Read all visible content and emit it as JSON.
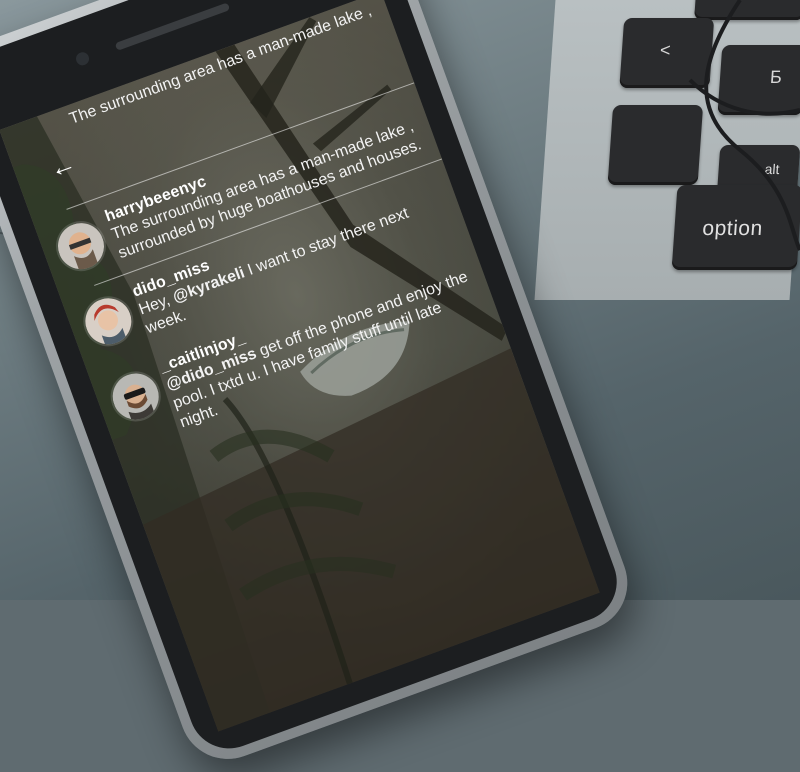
{
  "keyboard": {
    "keys": {
      "lt": "<",
      "cyr": "Б",
      "alt": "alt",
      "option": "option"
    }
  },
  "screen": {
    "back_icon": "arrow-left-icon",
    "comments": [
      {
        "username": "",
        "text": "The surrounding area has a man-made lake ,"
      },
      {
        "username": "harrybeeenyc",
        "text": "The surrounding area has a man-made lake ,",
        "text2": "surrounded by huge boathouses and houses."
      },
      {
        "username": "dido_miss",
        "text_before": "Hey, ",
        "mention": "@kyrakeli",
        "text_after": " I want to stay there next week."
      },
      {
        "username": "_caitlinjoy_",
        "mention": "@dido_miss",
        "text_after": " get off the phone and enjoy the pool. I txtd u. I have family stuff until late night."
      }
    ]
  },
  "colors": {
    "text": "#ffffff",
    "keycap": "#2a2b2d"
  }
}
